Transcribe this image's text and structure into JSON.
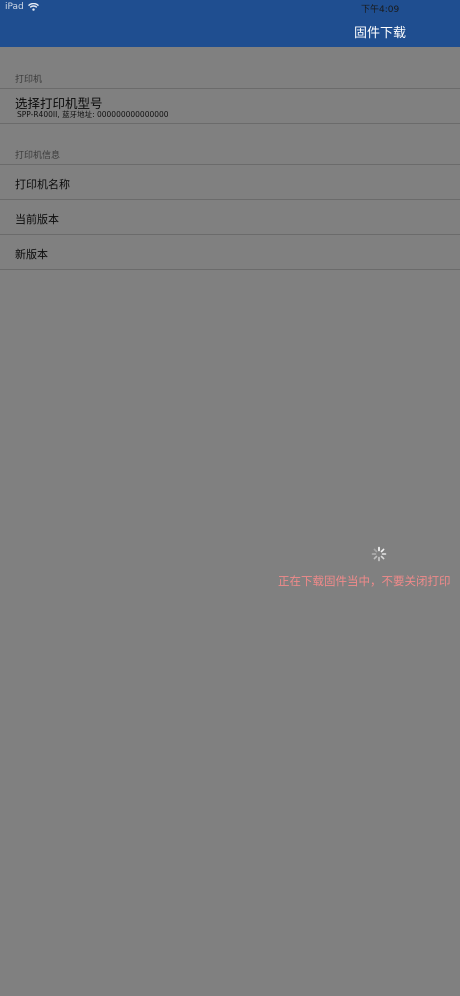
{
  "status_bar": {
    "device": "iPad",
    "time": "下午4:09",
    "wifi_icon": "wifi-icon"
  },
  "nav": {
    "title": "固件下载"
  },
  "sections": {
    "printer": {
      "header": "打印机",
      "select_model": {
        "title": "选择打印机型号",
        "subtitle": "SPP-R400II, 蓝牙地址: 000000000000000"
      }
    },
    "printer_info": {
      "header": "打印机信息",
      "rows": [
        "打印机名称",
        "当前版本",
        "新版本"
      ]
    }
  },
  "loading": {
    "icon": "activity-spinner-icon",
    "message": "正在下载固件当中，不要关闭打印"
  },
  "colors": {
    "nav_background": "#1f4e90",
    "overlay_gray": "#808080",
    "loading_text": "#f08a8a"
  }
}
